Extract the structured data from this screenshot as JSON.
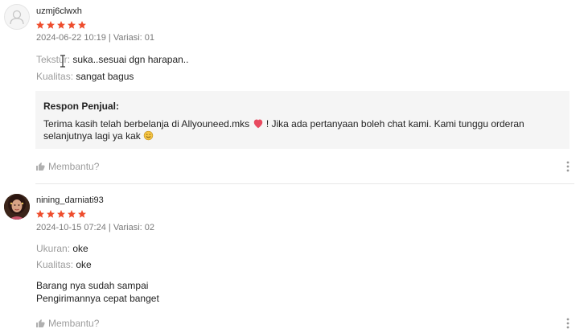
{
  "colors": {
    "star": "#ee4d2d",
    "heart": "#e84a5f",
    "text_muted": "rgba(0,0,0,0.4)",
    "box_bg": "#f5f5f5"
  },
  "reviews": [
    {
      "username": "uzmj6clwxh",
      "rating": 5,
      "datetime": "2024-06-22 10:19",
      "separator": " | ",
      "variation": "Variasi: 01",
      "attributes": [
        {
          "key": "Tekstur",
          "sep": ": ",
          "value": "suka..sesuai dgn harapan.."
        },
        {
          "key": "Kualitas",
          "sep": ": ",
          "value": "sangat bagus"
        }
      ],
      "seller_response": {
        "title": "Respon Penjual:",
        "text_part1": "Terima kasih telah berbelanja di Allyouneed.mks",
        "text_part2": " ! Jika ada pertanyaan boleh chat kami. Kami tunggu orderan selanjutnya lagi ya kak ",
        "icons": [
          "heart-icon",
          "smile-emoji-icon"
        ]
      },
      "helpful_label": "Membantu?",
      "avatar": "default-user-icon"
    },
    {
      "username": "nining_darniati93",
      "rating": 5,
      "datetime": "2024-10-15 07:24",
      "separator": " | ",
      "variation": "Variasi: 02",
      "attributes": [
        {
          "key": "Ukuran",
          "sep": ": ",
          "value": "oke"
        },
        {
          "key": "Kualitas",
          "sep": ": ",
          "value": "oke"
        }
      ],
      "comment_lines": [
        "Barang nya sudah sampai",
        "Pengirimannya cepat banget"
      ],
      "helpful_label": "Membantu?",
      "avatar": "user-photo"
    }
  ]
}
